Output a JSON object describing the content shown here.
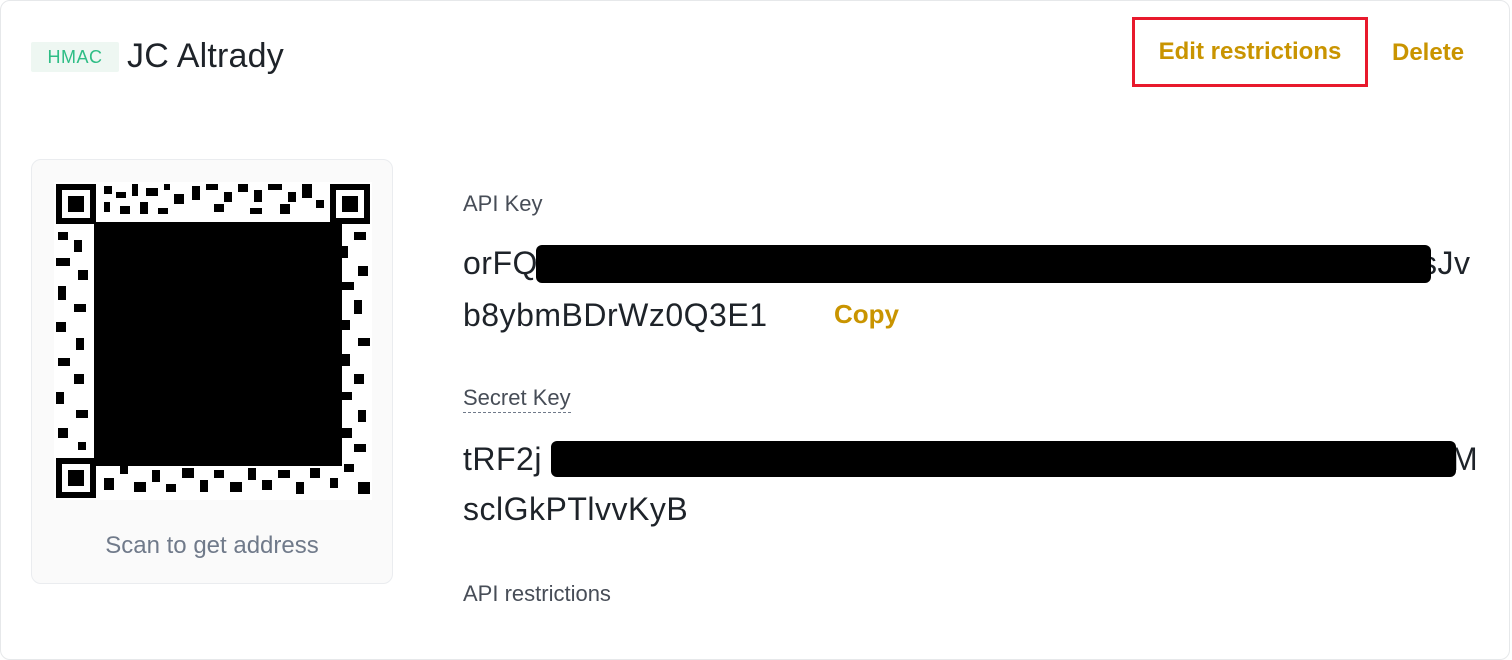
{
  "header": {
    "badge": "HMAC",
    "title": "JC Altrady",
    "edit_label": "Edit restrictions",
    "delete_label": "Delete"
  },
  "qr": {
    "icon": "qr-code-icon",
    "caption": "Scan to get address"
  },
  "api_key": {
    "label": "API Key",
    "line1_start": "orFQ",
    "line1_end": "sJv",
    "line2": "b8ybmBDrWz0Q3E1",
    "copy_label": "Copy"
  },
  "secret_key": {
    "label": "Secret Key",
    "line1_start": "tRF2j",
    "line1_end": "M",
    "line2": "sclGkPTlvvKyB"
  },
  "restrictions": {
    "label": "API restrictions"
  },
  "colors": {
    "accent": "#c99400",
    "badge_text": "#2ebd85",
    "badge_bg": "#eef7f2",
    "highlight_border": "#e8192c"
  }
}
